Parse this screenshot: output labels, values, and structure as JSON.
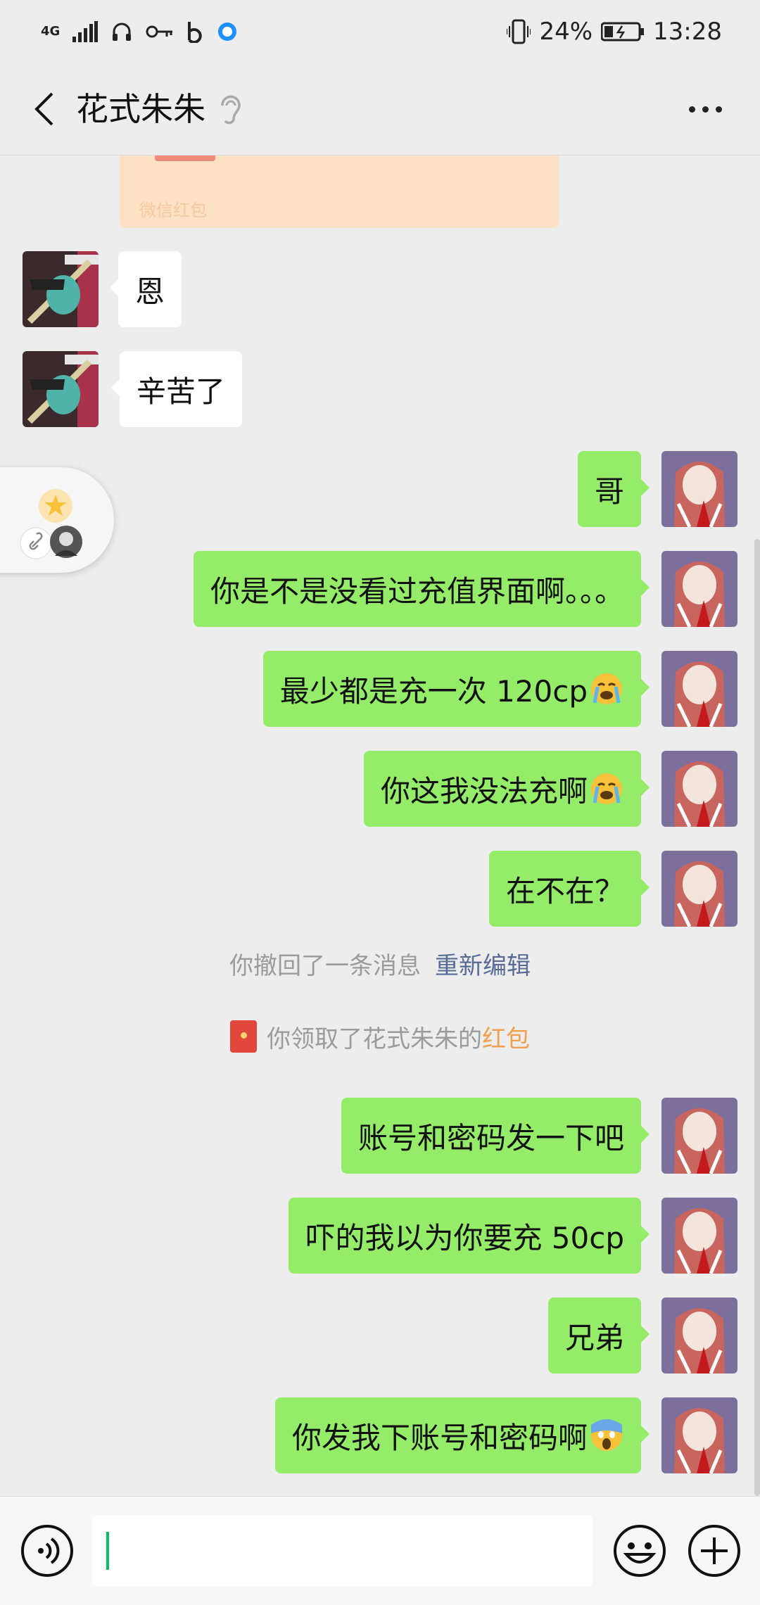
{
  "status_bar": {
    "network": "4G",
    "battery": "24%",
    "time": "13:28"
  },
  "header": {
    "title": "花式朱朱"
  },
  "red_packet": {
    "label": "微信红包"
  },
  "messages": [
    {
      "side": "in",
      "text": "恩"
    },
    {
      "side": "in",
      "text": "辛苦了"
    },
    {
      "side": "out",
      "text": "哥"
    },
    {
      "side": "out",
      "text": "你是不是没看过充值界面啊。。。"
    },
    {
      "side": "out",
      "text": "最少都是充一次 120cp",
      "emoji": "loudly-crying-face"
    },
    {
      "side": "out",
      "text": "你这我没法充啊",
      "emoji": "loudly-crying-face"
    },
    {
      "side": "out",
      "text": "在不在？"
    },
    {
      "side": "out",
      "text": "账号和密码发一下吧"
    },
    {
      "side": "out",
      "text": "吓的我以为你要充 50cp"
    },
    {
      "side": "out",
      "text": "兄弟"
    },
    {
      "side": "out",
      "text": "你发我下账号和密码啊",
      "emoji": "screaming-face"
    }
  ],
  "system": {
    "recall_text": "你撤回了一条消息",
    "recall_action": "重新编辑",
    "redpacket_text": "你领取了花式朱朱的",
    "redpacket_link": "红包"
  },
  "colors": {
    "outgoing_bubble": "#95ec69",
    "incoming_bubble": "#ffffff",
    "background": "#ededed",
    "link": "#576b95",
    "red_packet": "#e2473b"
  }
}
